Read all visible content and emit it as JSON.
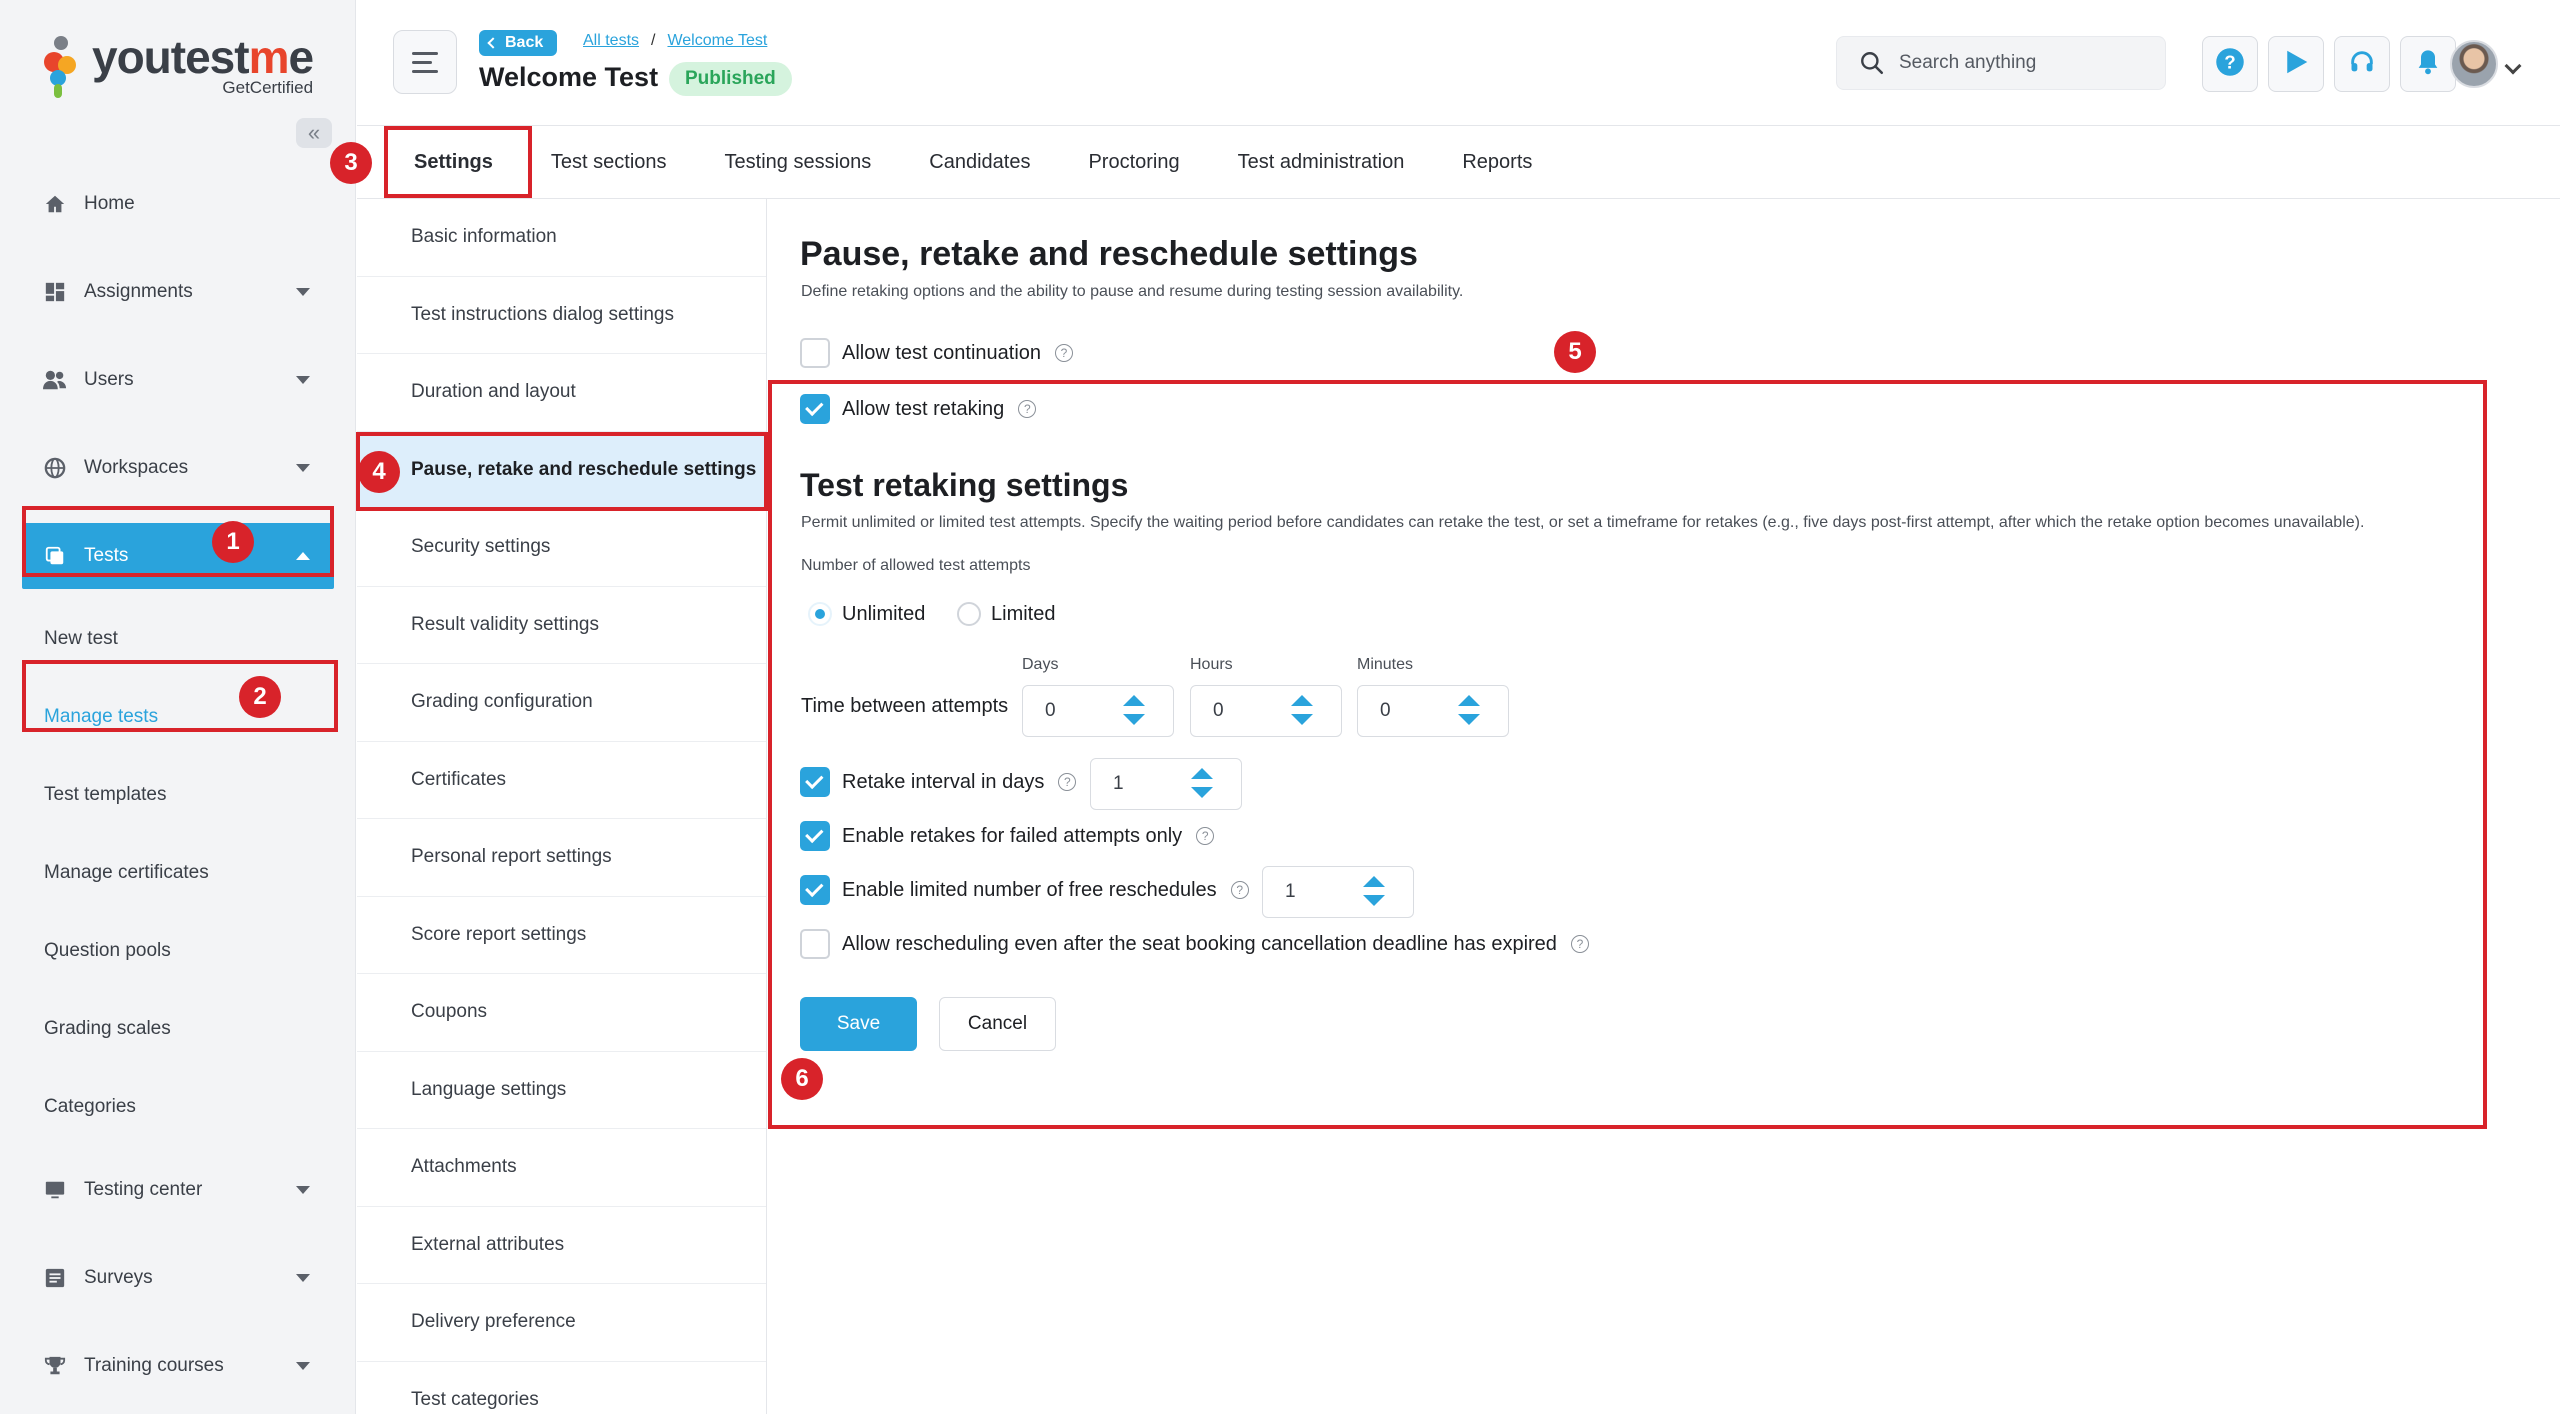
{
  "brand": {
    "word_start": "youtest",
    "word_accent": "m",
    "word_end": "e",
    "sub": "GetCertified",
    "accent_color": "#2aa3dc",
    "logo_accent_color": "#e8452c"
  },
  "nav": {
    "home": "Home",
    "assignments": "Assignments",
    "users": "Users",
    "workspaces": "Workspaces",
    "tests": "Tests",
    "tests_sub": {
      "new_test": "New test",
      "manage_tests": "Manage tests",
      "test_templates": "Test templates",
      "manage_certificates": "Manage certificates",
      "question_pools": "Question pools",
      "grading_scales": "Grading scales",
      "categories": "Categories"
    },
    "testing_center": "Testing center",
    "surveys": "Surveys",
    "training_courses": "Training courses"
  },
  "annotations": [
    "1",
    "2",
    "3",
    "4",
    "5",
    "6"
  ],
  "header": {
    "back_label": "Back",
    "crumb_all_tests": "All tests",
    "crumb_sep": "/",
    "crumb_current": "Welcome Test",
    "title": "Welcome Test",
    "status": "Published",
    "search_placeholder": "Search anything"
  },
  "tabs": [
    "Settings",
    "Test sections",
    "Testing sessions",
    "Candidates",
    "Proctoring",
    "Test administration",
    "Reports"
  ],
  "submenu": [
    "Basic information",
    "Test instructions dialog settings",
    "Duration and layout",
    "Pause, retake and reschedule settings",
    "Security settings",
    "Result validity settings",
    "Grading configuration",
    "Certificates",
    "Personal report settings",
    "Score report settings",
    "Coupons",
    "Language settings",
    "Attachments",
    "External attributes",
    "Delivery preference",
    "Test categories"
  ],
  "main": {
    "title": "Pause, retake and reschedule settings",
    "description": "Define retaking options and the ability to pause and resume during testing session availability.",
    "allow_continuation": {
      "label": "Allow test continuation",
      "checked": false
    },
    "allow_retaking": {
      "label": "Allow test retaking",
      "checked": true
    },
    "retake_title": "Test retaking settings",
    "retake_description": "Permit unlimited or limited test attempts. Specify the waiting period before candidates can retake the test, or set a timeframe for retakes (e.g., five days post-first attempt, after which the retake option becomes unavailable).",
    "attempts_label": "Number of allowed test attempts",
    "radio_unlimited": "Unlimited",
    "radio_limited": "Limited",
    "selected_attempts": "Unlimited",
    "time_between_label": "Time between attempts",
    "days_label": "Days",
    "hours_label": "Hours",
    "minutes_label": "Minutes",
    "days_value": "0",
    "hours_value": "0",
    "minutes_value": "0",
    "retake_interval": {
      "label": "Retake interval in days",
      "checked": true,
      "value": "1"
    },
    "failed_only": {
      "label": "Enable retakes for failed attempts only",
      "checked": true
    },
    "free_reschedules": {
      "label": "Enable limited number of free reschedules",
      "checked": true,
      "value": "1"
    },
    "after_deadline": {
      "label": "Allow rescheduling even after the seat booking cancellation deadline has expired",
      "checked": false
    },
    "save_label": "Save",
    "cancel_label": "Cancel"
  }
}
